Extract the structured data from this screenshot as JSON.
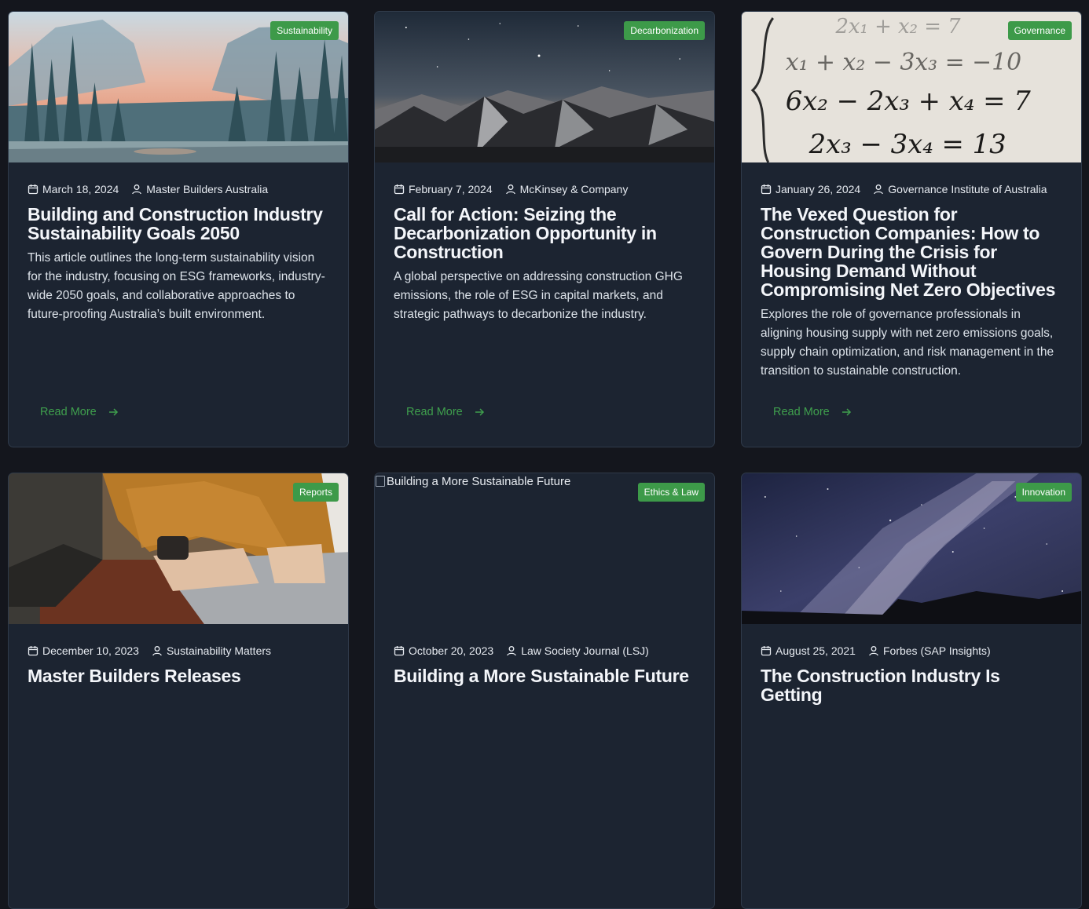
{
  "cards": [
    {
      "category": "Sustainability",
      "date": "March 18, 2024",
      "author": "Master Builders Australia",
      "title": "Building and Construction Industry Sustainability Goals 2050",
      "description": "This article outlines the long-term sustainability vision for the industry, focusing on ESG frameworks, industry-wide 2050 goals, and collaborative approaches to future-proofing Australia’s built environment.",
      "read_more": "Read More"
    },
    {
      "category": "Decarbonization",
      "date": "February 7, 2024",
      "author": "McKinsey & Company",
      "title": "Call for Action: Seizing the Decarbonization Opportunity in Construction",
      "description": "A global perspective on addressing construction GHG emissions, the role of ESG in capital markets, and strategic pathways to decarbonize the industry.",
      "read_more": "Read More"
    },
    {
      "category": "Governance",
      "date": "January 26, 2024",
      "author": "Governance Institute of Australia",
      "title": "The Vexed Question for Construction Companies: How to Govern During the Crisis for Housing Demand Without Compromising Net Zero Objectives",
      "description": "Explores the role of governance professionals in aligning housing supply with net zero emissions goals, supply chain optimization, and risk management in the transition to sustainable construction.",
      "read_more": "Read More",
      "image_text": [
        "2x₁ + x₂ = 7",
        "x₁ + x₂ − 3x₃ = −10",
        "6x₂ − 2x₃ + x₄ = 7",
        "2x₃ − 3x₄ = 13"
      ]
    },
    {
      "category": "Reports",
      "date": "December 10, 2023",
      "author": "Sustainability Matters",
      "title": "Master Builders Releases",
      "description": "",
      "read_more": ""
    },
    {
      "category": "Ethics & Law",
      "date": "October 20, 2023",
      "author": "Law Society Journal (LSJ)",
      "title": "Building a More Sustainable Future",
      "image_alt": "Building a More Sustainable Future",
      "description": "",
      "read_more": ""
    },
    {
      "category": "Innovation",
      "date": "August 25, 2021",
      "author": "Forbes (SAP Insights)",
      "title": "The Construction Industry Is Getting",
      "description": "",
      "read_more": ""
    }
  ],
  "icons": {
    "date": "calendar-icon",
    "author": "user-icon",
    "read_more": "arrow-right-icon"
  },
  "colors": {
    "page_bg": "#14161d",
    "card_bg": "#1c2431",
    "accent": "#3d9a49",
    "link": "#3f9f4d"
  }
}
